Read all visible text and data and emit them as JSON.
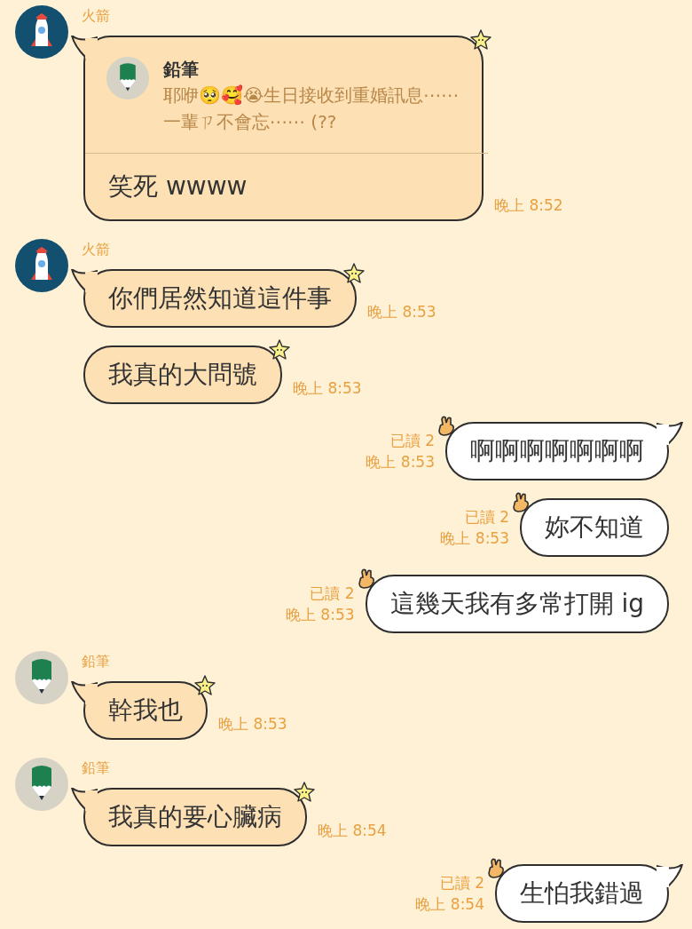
{
  "messages": [
    {
      "kind": "incoming",
      "sender": "火箭",
      "avatar": {
        "kind": "rocket"
      },
      "tail": true,
      "text": "笑死 wwww",
      "time": "晚上 8:52",
      "reply": {
        "avatar": {
          "kind": "pencil"
        },
        "name": "鉛筆",
        "text": "耶咿🥺🥰😭生日接收到重婚訊息⋯⋯一輩ㄗ不會忘⋯⋯ (??"
      }
    },
    {
      "kind": "incoming",
      "sender": "火箭",
      "avatar": {
        "kind": "rocket"
      },
      "tail": true,
      "text": "你們居然知道這件事",
      "time": "晚上 8:53"
    },
    {
      "kind": "incoming",
      "tail": false,
      "text": "我真的大問號",
      "time": "晚上 8:53"
    },
    {
      "kind": "outgoing",
      "tail": true,
      "text": "啊啊啊啊啊啊啊",
      "read": "已讀 2",
      "time": "晚上 8:53"
    },
    {
      "kind": "outgoing",
      "tail": false,
      "text": "妳不知道",
      "read": "已讀 2",
      "time": "晚上 8:53"
    },
    {
      "kind": "outgoing",
      "tail": false,
      "text": "這幾天我有多常打開 ig",
      "read": "已讀 2",
      "time": "晚上 8:53"
    },
    {
      "kind": "incoming",
      "sender": "鉛筆",
      "avatar": {
        "kind": "pencil"
      },
      "tail": true,
      "text": "幹我也",
      "time": "晚上 8:53"
    },
    {
      "kind": "incoming",
      "sender": "鉛筆",
      "avatar": {
        "kind": "pencil"
      },
      "tail": true,
      "text": "我真的要心臟病",
      "time": "晚上 8:54"
    },
    {
      "kind": "outgoing",
      "tail": true,
      "text": "生怕我錯過",
      "read": "已讀 2",
      "time": "晚上 8:54"
    }
  ]
}
